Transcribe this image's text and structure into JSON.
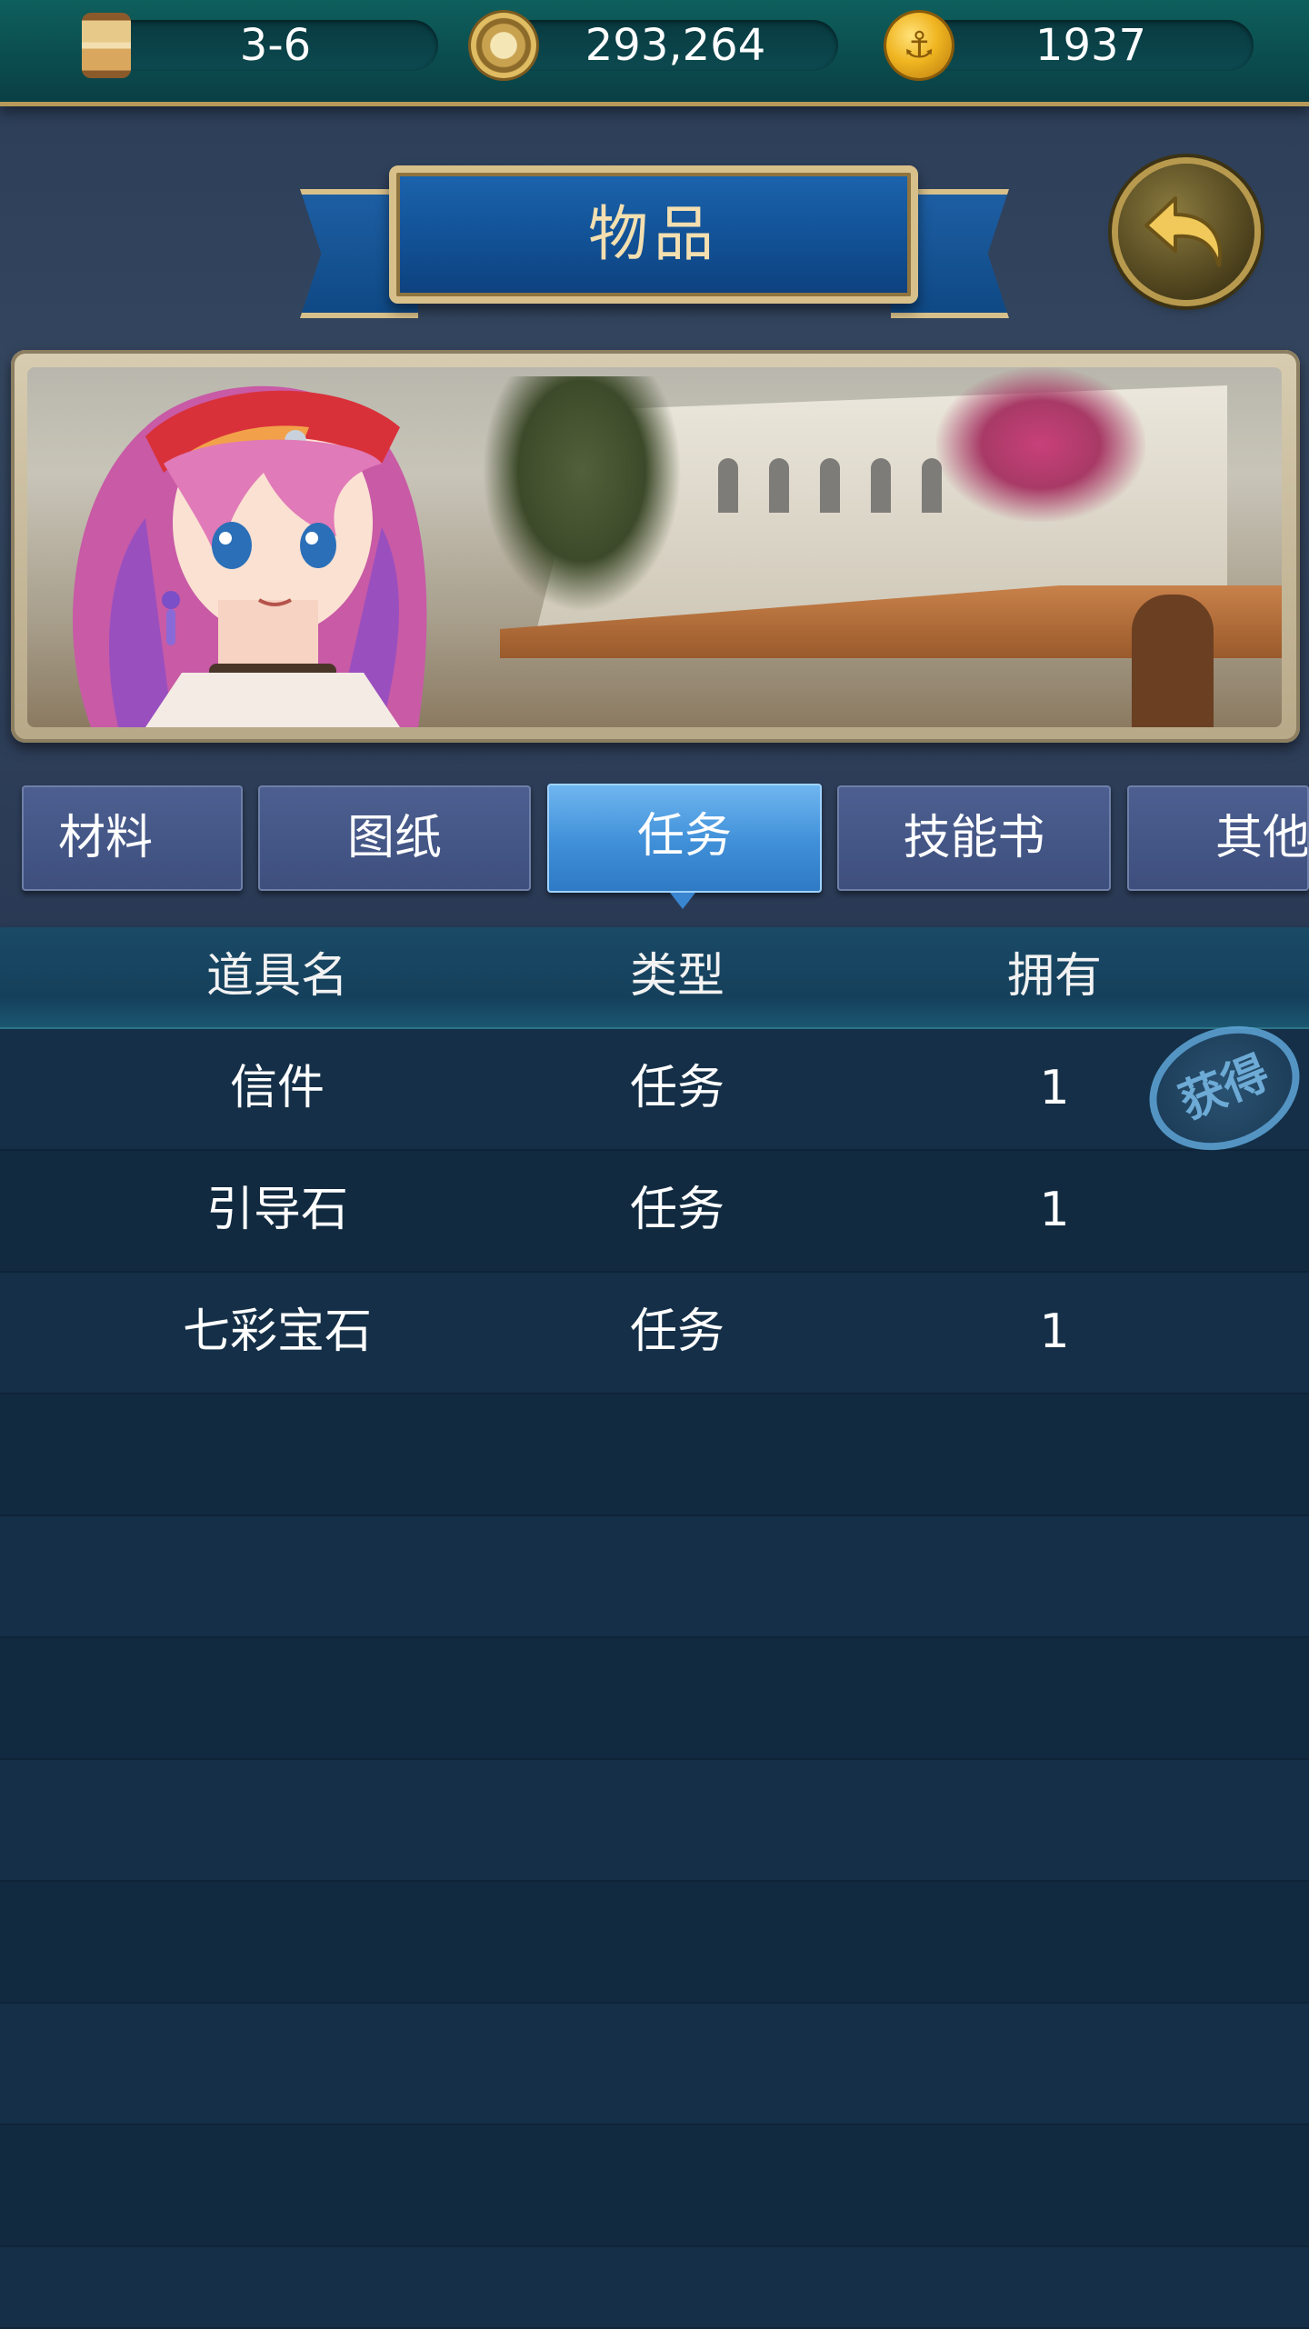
{
  "resources": [
    {
      "icon": "hourglass-icon",
      "value": "3-6"
    },
    {
      "icon": "compass-icon",
      "value": "293,264"
    },
    {
      "icon": "anchor-coin-icon",
      "value": "1937"
    }
  ],
  "title": "物品",
  "tabs": [
    {
      "label": "材料",
      "active": false
    },
    {
      "label": "图纸",
      "active": false
    },
    {
      "label": "任务",
      "active": true
    },
    {
      "label": "技能书",
      "active": false
    },
    {
      "label": "其他",
      "active": false
    }
  ],
  "table": {
    "headers": [
      "道具名",
      "类型",
      "拥有"
    ],
    "rows": [
      {
        "name": "信件",
        "type": "任务",
        "owned": "1"
      },
      {
        "name": "引导石",
        "type": "任务",
        "owned": "1"
      },
      {
        "name": "七彩宝石",
        "type": "任务",
        "owned": "1"
      }
    ]
  },
  "stamp": "获得",
  "colors": {
    "topbar": "#0e5f5d",
    "banner": "#1b64ad",
    "tab_active": "#3f8fd8",
    "tab_inactive": "#4c5f90",
    "table_bg": "#132d44"
  }
}
